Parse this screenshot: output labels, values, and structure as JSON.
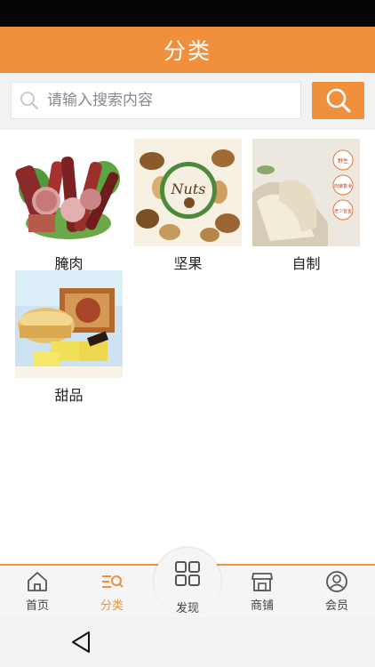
{
  "header": {
    "title": "分类"
  },
  "search": {
    "placeholder": "请输入搜索内容",
    "value": ""
  },
  "categories": [
    {
      "label": "腌肉",
      "image": "cured-meat-image"
    },
    {
      "label": "坚果",
      "image": "nuts-image",
      "logo_text": "Nuts"
    },
    {
      "label": "自制",
      "image": "homemade-food-image",
      "badges": [
        "野生",
        "肉嫩香滑",
        "老少皆宜"
      ]
    },
    {
      "label": "甜品",
      "image": "dessert-image"
    }
  ],
  "tabbar": {
    "items": [
      {
        "label": "首页",
        "icon": "home-icon"
      },
      {
        "label": "分类",
        "icon": "category-icon",
        "active": true
      },
      {
        "label": "发现",
        "icon": "discover-icon"
      },
      {
        "label": "商铺",
        "icon": "shop-icon"
      },
      {
        "label": "会员",
        "icon": "member-icon"
      }
    ]
  },
  "colors": {
    "accent": "#f08f3c",
    "statusbar": "#050505",
    "tabbar_bg": "#f5f5f5"
  }
}
